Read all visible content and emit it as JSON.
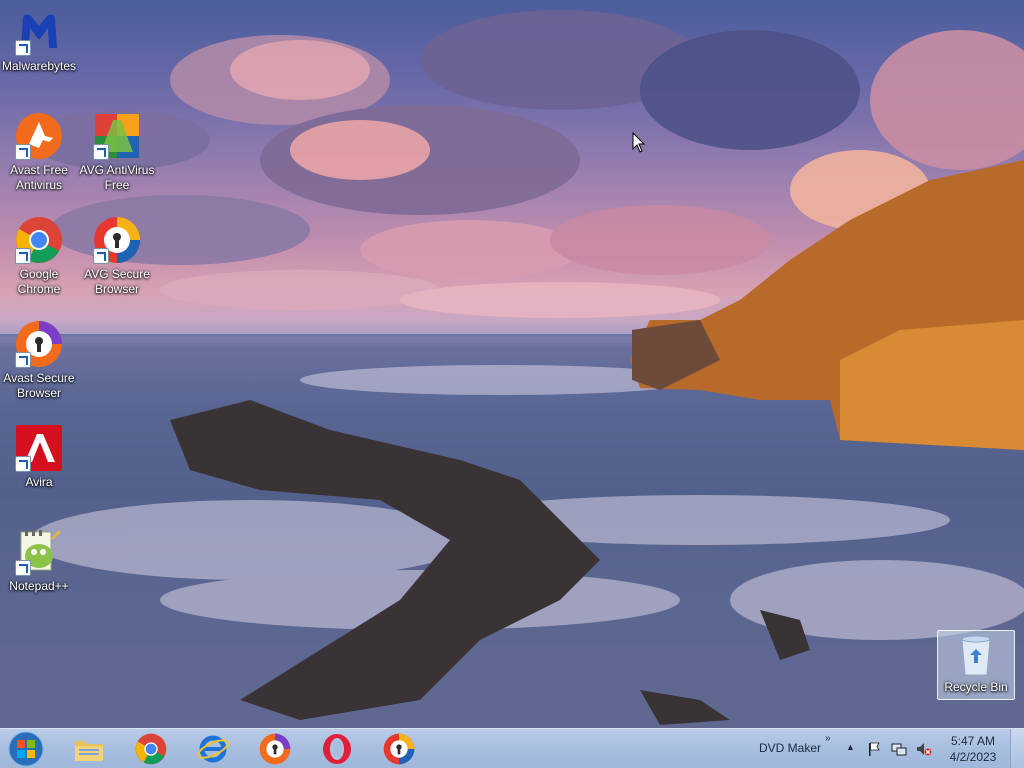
{
  "desktop": {
    "icons": [
      {
        "label": "Malwarebytes",
        "icon": "malwarebytes-icon"
      },
      {
        "label": "Avast Free Antivirus",
        "icon": "avast-icon"
      },
      {
        "label": "AVG AntiVirus Free",
        "icon": "avg-icon"
      },
      {
        "label": "Google Chrome",
        "icon": "chrome-icon"
      },
      {
        "label": "AVG Secure Browser",
        "icon": "avg-secure-browser-icon"
      },
      {
        "label": "Avast Secure Browser",
        "icon": "avast-secure-browser-icon"
      },
      {
        "label": "Avira",
        "icon": "avira-icon"
      },
      {
        "label": "Notepad++",
        "icon": "notepadpp-icon"
      },
      {
        "label": "Recycle Bin",
        "icon": "recycle-bin-icon"
      }
    ]
  },
  "taskbar": {
    "start": {
      "icon": "windows-start-icon"
    },
    "pinned": [
      {
        "name": "file-explorer",
        "icon": "folder-icon"
      },
      {
        "name": "google-chrome",
        "icon": "chrome-icon"
      },
      {
        "name": "internet-explorer",
        "icon": "ie-icon"
      },
      {
        "name": "avast-secure-browser",
        "icon": "avast-secure-browser-icon"
      },
      {
        "name": "opera",
        "icon": "opera-icon"
      },
      {
        "name": "avg-secure-browser",
        "icon": "avg-secure-browser-icon"
      }
    ],
    "tray": {
      "app_label": "DVD Maker",
      "chevron": "»",
      "show_hidden": "▲",
      "icons": [
        "flag-icon",
        "network-icon",
        "volume-muted-icon"
      ]
    },
    "clock": {
      "time": "5:47 AM",
      "date": "4/2/2023"
    }
  },
  "colors": {
    "taskbar": "#a7bedf",
    "chrome_red": "#db4437",
    "chrome_green": "#0f9d58",
    "chrome_yellow": "#f4b400",
    "chrome_blue": "#4285f4",
    "avast_orange": "#f26b1d",
    "avira_red": "#d50f1f",
    "opera_red": "#e0203a"
  }
}
